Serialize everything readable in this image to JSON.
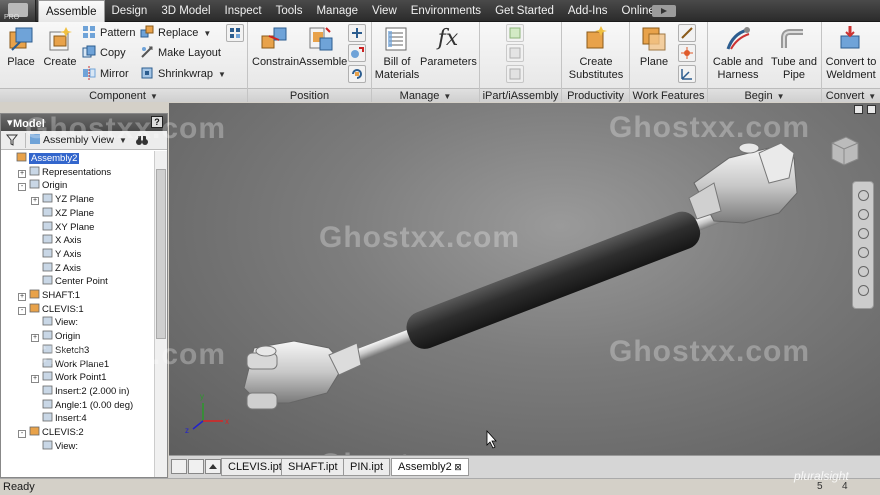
{
  "menubar": {
    "tabs": [
      {
        "label": "Assemble",
        "active": true
      },
      {
        "label": "Design"
      },
      {
        "label": "3D Model"
      },
      {
        "label": "Inspect"
      },
      {
        "label": "Tools"
      },
      {
        "label": "Manage"
      },
      {
        "label": "View"
      },
      {
        "label": "Environments"
      },
      {
        "label": "Get Started"
      },
      {
        "label": "Add-Ins"
      },
      {
        "label": "Online"
      }
    ],
    "app_badge": "PRO"
  },
  "ribbon": {
    "component": {
      "title": "Component",
      "place": "Place",
      "create": "Create",
      "pattern": "Pattern",
      "copy": "Copy",
      "mirror": "Mirror",
      "replace": "Replace",
      "make_layout": "Make Layout",
      "shrinkwrap": "Shrinkwrap"
    },
    "position": {
      "title": "Position",
      "constrain": "Constrain",
      "assemble": "Assemble"
    },
    "manage": {
      "title": "Manage",
      "bill_line1": "Bill of",
      "bill_line2": "Materials",
      "parameters": "Parameters",
      "fx": "fx"
    },
    "ipart": {
      "title": "iPart/iAssembly"
    },
    "productivity": {
      "title": "Productivity",
      "create_sub_line1": "Create",
      "create_sub_line2": "Substitutes"
    },
    "work_features": {
      "title": "Work Features",
      "plane": "Plane"
    },
    "begin": {
      "title": "Begin",
      "cable_line1": "Cable and",
      "cable_line2": "Harness",
      "tube_line1": "Tube and",
      "tube_line2": "Pipe"
    },
    "convert": {
      "title": "Convert",
      "weld_line1": "Convert to",
      "weld_line2": "Weldment"
    }
  },
  "browser": {
    "title": "Model",
    "view_mode": "Assembly View",
    "tree": [
      {
        "label": "Assembly2",
        "indent": 0,
        "selected": true,
        "exp": ""
      },
      {
        "label": "Representations",
        "indent": 1,
        "exp": "+"
      },
      {
        "label": "Origin",
        "indent": 1,
        "exp": "-"
      },
      {
        "label": "YZ Plane",
        "indent": 2,
        "exp": "+"
      },
      {
        "label": "XZ Plane",
        "indent": 2,
        "exp": ""
      },
      {
        "label": "XY Plane",
        "indent": 2,
        "exp": ""
      },
      {
        "label": "X Axis",
        "indent": 2,
        "exp": ""
      },
      {
        "label": "Y Axis",
        "indent": 2,
        "exp": ""
      },
      {
        "label": "Z Axis",
        "indent": 2,
        "exp": ""
      },
      {
        "label": "Center Point",
        "indent": 2,
        "exp": ""
      },
      {
        "label": "SHAFT:1",
        "indent": 1,
        "exp": "+"
      },
      {
        "label": "CLEVIS:1",
        "indent": 1,
        "exp": "-"
      },
      {
        "label": "View:",
        "indent": 2,
        "exp": ""
      },
      {
        "label": "Origin",
        "indent": 2,
        "exp": "+"
      },
      {
        "label": "Sketch3",
        "indent": 2,
        "exp": ""
      },
      {
        "label": "Work Plane1",
        "indent": 2,
        "exp": ""
      },
      {
        "label": "Work Point1",
        "indent": 2,
        "exp": "+"
      },
      {
        "label": "Insert:2 (2.000 in)",
        "indent": 2,
        "exp": ""
      },
      {
        "label": "Angle:1 (0.00 deg)",
        "indent": 2,
        "exp": ""
      },
      {
        "label": "Insert:4",
        "indent": 2,
        "exp": ""
      },
      {
        "label": "CLEVIS:2",
        "indent": 1,
        "exp": "-"
      },
      {
        "label": "View:",
        "indent": 2,
        "exp": ""
      }
    ]
  },
  "doc_tabs": [
    {
      "label": "CLEVIS.ipt"
    },
    {
      "label": "SHAFT.ipt"
    },
    {
      "label": "PIN.ipt"
    },
    {
      "label": "Assembly2",
      "active": true
    }
  ],
  "status": {
    "text": "Ready",
    "num1": "5",
    "num2": "4",
    "brand": "pluralsight"
  },
  "axis": {
    "x": "x",
    "y": "y",
    "z": "z"
  },
  "watermark": "Ghostxx.com"
}
